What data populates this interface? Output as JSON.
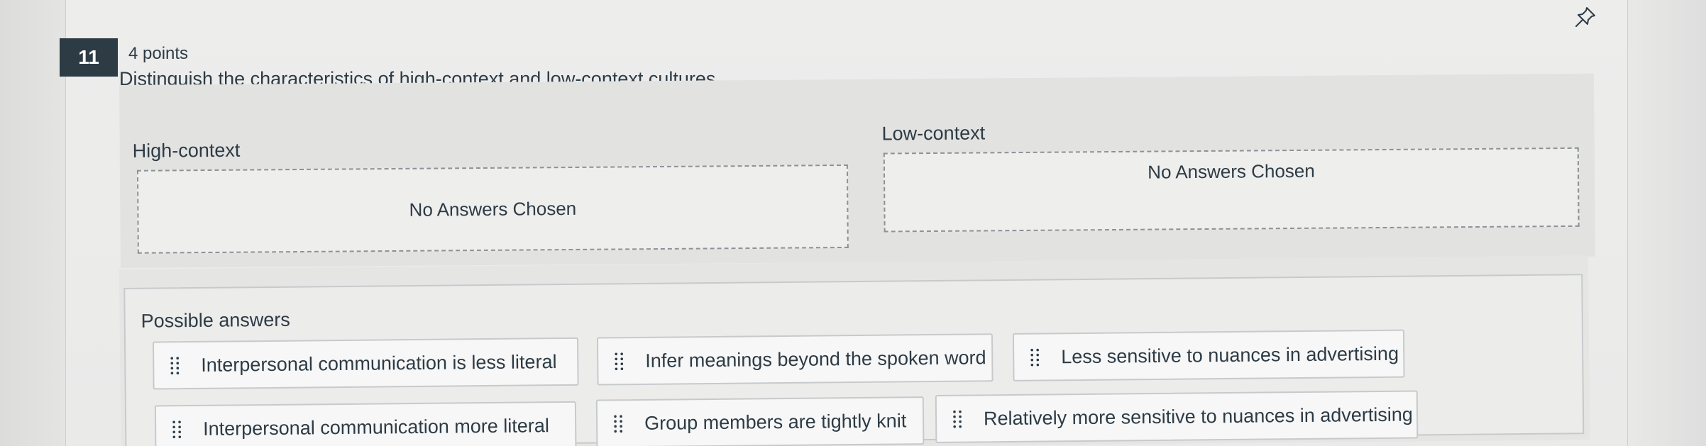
{
  "question": {
    "number": "11",
    "points": "4 points",
    "prompt": "Distinguish the characteristics of high-context and low-context cultures."
  },
  "groups": [
    {
      "label": "High-context",
      "placeholder": "No Answers Chosen"
    },
    {
      "label": "Low-context",
      "placeholder": "No Answers Chosen"
    }
  ],
  "possible_answers": {
    "label": "Possible answers",
    "items": [
      "Interpersonal communication is less literal",
      "Infer meanings beyond the spoken word",
      "Less sensitive to nuances in advertising",
      "Interpersonal communication more literal",
      "Group members are tightly knit",
      "Relatively more sensitive to nuances in advertising"
    ]
  },
  "icons": {
    "pin": "pin-icon",
    "drag_handle": "drag-handle-icon"
  },
  "colors": {
    "question_badge": "#2d3b45",
    "text": "#2d3b45",
    "dashed_border": "#8c9297",
    "chip_background": "#f7f7f7"
  }
}
